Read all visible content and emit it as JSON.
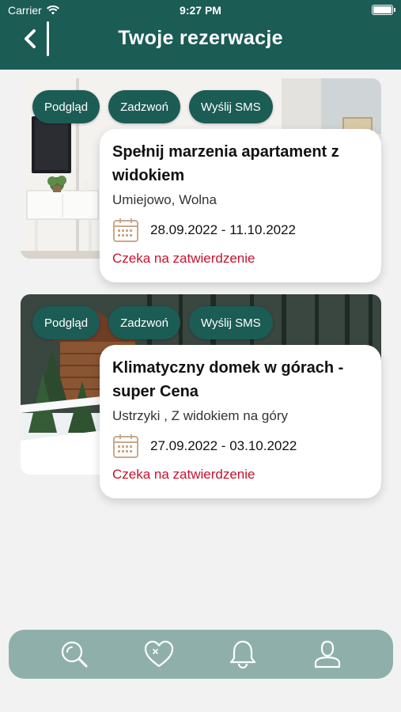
{
  "status_bar": {
    "carrier": "Carrier",
    "time": "9:27 PM"
  },
  "header": {
    "title": "Twoje rezerwacje"
  },
  "reservations": [
    {
      "actions": {
        "preview": "Podgląd",
        "call": "Zadzwoń",
        "sms": "Wyślij SMS"
      },
      "title": "Spełnij marzenia apartament z widokiem",
      "location": "Umiejowo, Wolna",
      "dates": "28.09.2022 - 11.10.2022",
      "status": "Czeka na zatwierdzenie",
      "photo": "apartment-interior"
    },
    {
      "actions": {
        "preview": "Podgląd",
        "call": "Zadzwoń",
        "sms": "Wyślij SMS"
      },
      "title": "Klimatyczny domek w górach - super Cena",
      "location": "Ustrzyki , Z widokiem na góry",
      "dates": "27.09.2022 - 03.10.2022",
      "status": "Czeka na zatwierdzenie",
      "photo": "winter-cabin"
    }
  ],
  "tabbar": {
    "items": [
      "search-icon",
      "heart-icon",
      "bell-icon",
      "user-icon"
    ]
  },
  "colors": {
    "primary": "#1b5c55",
    "status": "#c8102e",
    "tabbar": "#8fb0aa",
    "background": "#f2f2f2"
  }
}
